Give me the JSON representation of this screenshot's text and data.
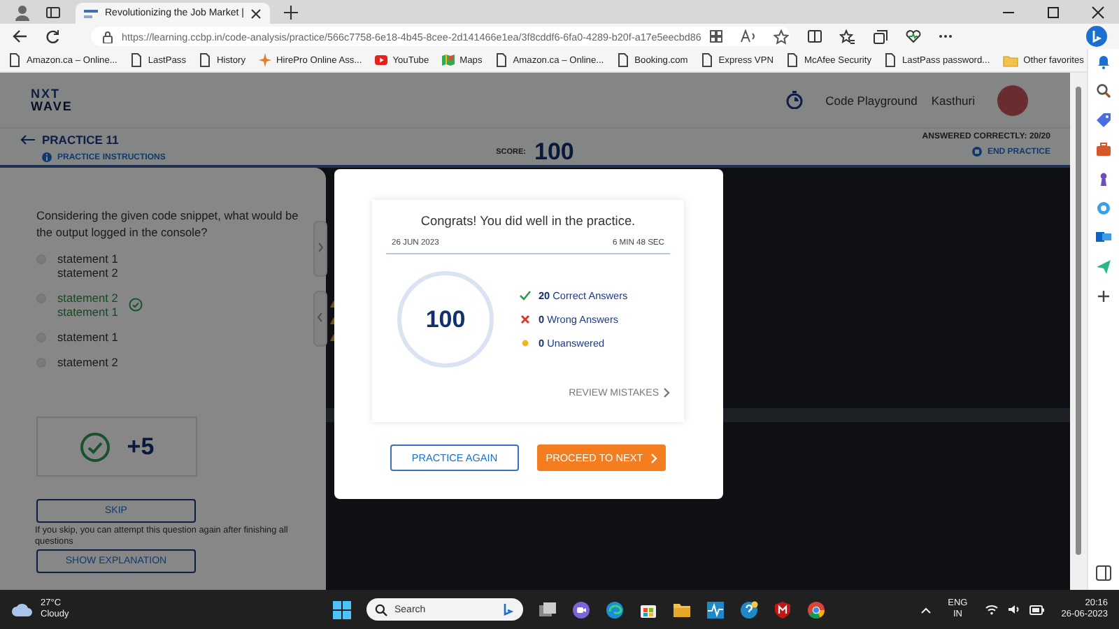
{
  "browser": {
    "tabs": [
      {
        "title": "Revolutionizing the Job Market |",
        "selected": true
      }
    ],
    "address": {
      "url": "https://learning.ccbp.in/code-analysis/practice/566c7758-6e18-4b45-8cee-2d141466e1ea/3f8cddf6-6fa0-4289-b20f-a17e5eecbd86"
    },
    "bookmarks": [
      {
        "label": "Amazon.ca – Online...",
        "kind": "page"
      },
      {
        "label": "LastPass",
        "kind": "page"
      },
      {
        "label": "History",
        "kind": "page"
      },
      {
        "label": "HirePro Online Ass...",
        "kind": "hirepro"
      },
      {
        "label": "YouTube",
        "kind": "youtube"
      },
      {
        "label": "Maps",
        "kind": "maps"
      },
      {
        "label": "Amazon.ca – Online...",
        "kind": "page"
      },
      {
        "label": "Booking.com",
        "kind": "page"
      },
      {
        "label": "Express VPN",
        "kind": "page"
      },
      {
        "label": "McAfee Security",
        "kind": "page"
      },
      {
        "label": "LastPass password...",
        "kind": "page"
      }
    ],
    "other_favorites": "Other favorites"
  },
  "header": {
    "logo_line1": "NXT",
    "logo_line2": "WAVE",
    "code_playground": "Code Playground",
    "user": "Kasthuri"
  },
  "practice": {
    "title": "PRACTICE 11",
    "instructions": "PRACTICE INSTRUCTIONS",
    "score_label": "SCORE:",
    "score": "100",
    "answered": "ANSWERED CORRECTLY: 20/20",
    "end": "END PRACTICE"
  },
  "question": {
    "text": "Considering the given code snippet, what would be the output logged in the console?",
    "options": [
      {
        "lines": [
          "statement 1",
          "statement 2"
        ],
        "correct": false,
        "selected": false
      },
      {
        "lines": [
          "statement 2",
          "statement 1"
        ],
        "correct": true,
        "selected": false
      },
      {
        "lines": [
          "statement 1"
        ],
        "correct": false,
        "selected": false
      },
      {
        "lines": [
          "statement 2"
        ],
        "correct": false,
        "selected": false
      }
    ],
    "result": "+5",
    "skip": "SKIP",
    "skip_note": "If you skip, you can attempt this question again after finishing all questions",
    "explanation": "SHOW EXPLANATION"
  },
  "modal": {
    "title": "Congrats! You did well in the practice.",
    "date": "26 JUN 2023",
    "duration": "6 MIN 48 SEC",
    "score": "100",
    "stats": [
      {
        "count": "20",
        "label": "Correct Answers",
        "kind": "correct"
      },
      {
        "count": "0",
        "label": "Wrong Answers",
        "kind": "wrong"
      },
      {
        "count": "0",
        "label": "Unanswered",
        "kind": "unanswered"
      }
    ],
    "review": "REVIEW MISTAKES",
    "practice_again": "PRACTICE AGAIN",
    "proceed": "PROCEED TO NEXT"
  },
  "taskbar": {
    "temperature": "27°C",
    "weather": "Cloudy",
    "search_placeholder": "Search",
    "language": "ENG",
    "region": "IN",
    "time": "20:16",
    "date": "26-06-2023"
  }
}
